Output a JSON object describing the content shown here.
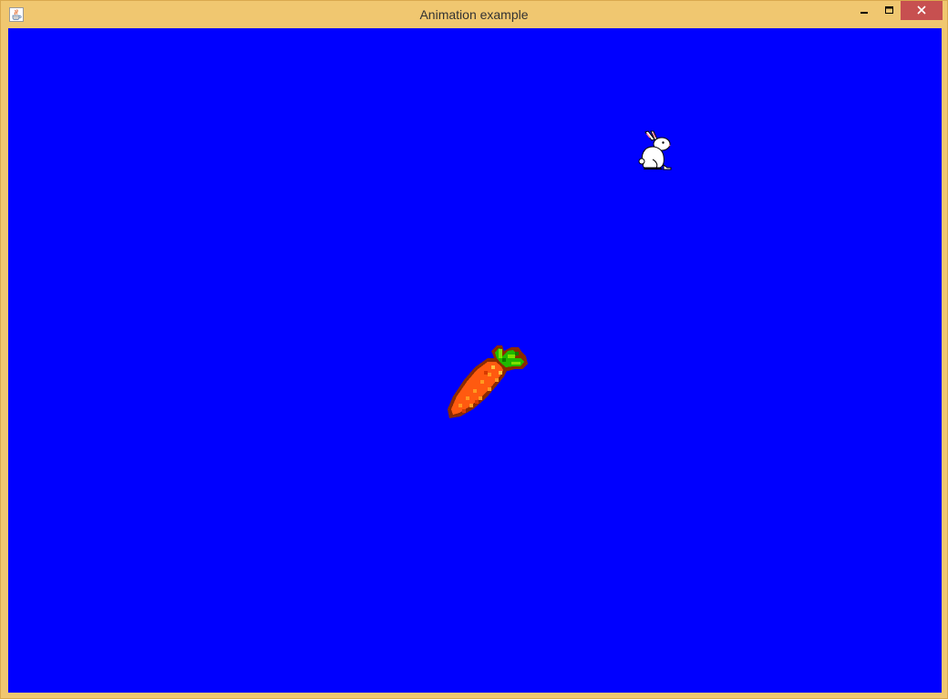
{
  "window": {
    "title": "Animation example",
    "icons": {
      "app": "java-coffee-cup-icon",
      "minimize": "minimize-icon",
      "maximize": "maximize-icon",
      "close": "close-icon"
    },
    "colors": {
      "frame": "#f0c770",
      "close_button": "#c75050",
      "canvas_background": "#0000ff"
    }
  },
  "canvas": {
    "sprites": [
      "rabbit",
      "carrot"
    ]
  }
}
